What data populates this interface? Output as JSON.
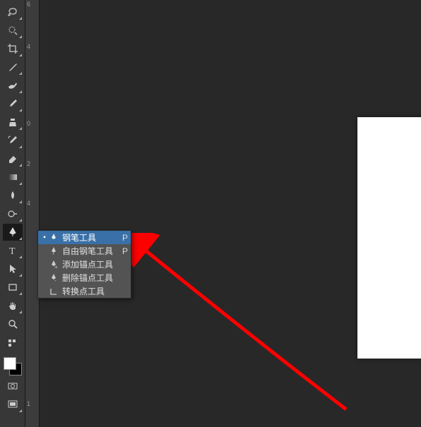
{
  "toolbar": {
    "tools": [
      {
        "name": "lasso-tool"
      },
      {
        "name": "quick-select-tool"
      },
      {
        "name": "crop-tool"
      },
      {
        "name": "eyedropper-tool"
      },
      {
        "name": "spot-healing-tool"
      },
      {
        "name": "brush-tool"
      },
      {
        "name": "clone-stamp-tool"
      },
      {
        "name": "history-brush-tool"
      },
      {
        "name": "eraser-tool"
      },
      {
        "name": "gradient-tool"
      },
      {
        "name": "blur-tool"
      },
      {
        "name": "dodge-tool"
      },
      {
        "name": "pen-tool"
      },
      {
        "name": "type-tool"
      },
      {
        "name": "path-selection-tool"
      },
      {
        "name": "rectangle-tool"
      },
      {
        "name": "hand-tool"
      },
      {
        "name": "zoom-tool"
      },
      {
        "name": "edit-toolbar"
      }
    ]
  },
  "ruler": {
    "ticks": [
      "6",
      "4",
      "0",
      "2",
      "4",
      "",
      "",
      "",
      "",
      "",
      "",
      "",
      "",
      "",
      "1"
    ]
  },
  "flyout": {
    "items": [
      {
        "label": "钢笔工具",
        "shortcut": "P",
        "selected": true,
        "icon": "pen"
      },
      {
        "label": "自由钢笔工具",
        "shortcut": "P",
        "selected": false,
        "icon": "freeform-pen"
      },
      {
        "label": "添加锚点工具",
        "shortcut": "",
        "selected": false,
        "icon": "add-anchor"
      },
      {
        "label": "删除锚点工具",
        "shortcut": "",
        "selected": false,
        "icon": "delete-anchor"
      },
      {
        "label": "转换点工具",
        "shortcut": "",
        "selected": false,
        "icon": "convert-point"
      }
    ]
  },
  "colors": {
    "fg": "#ffffff",
    "bg": "#000000"
  }
}
